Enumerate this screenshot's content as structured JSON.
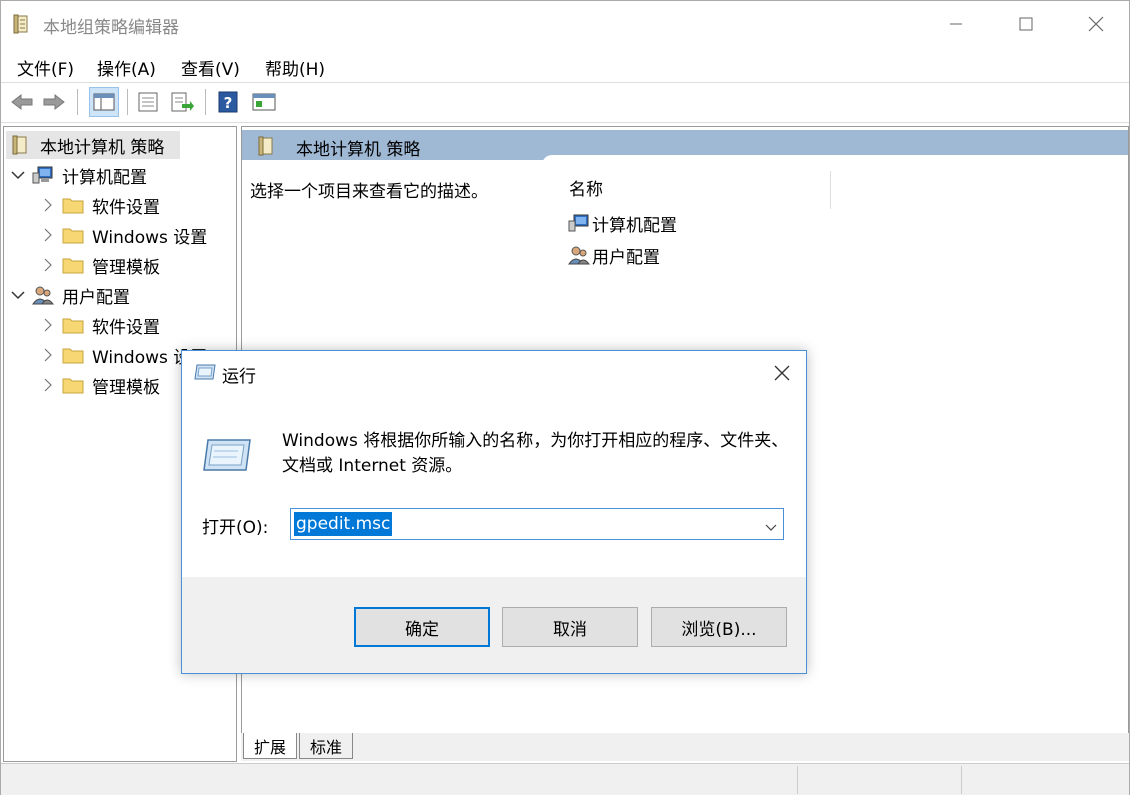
{
  "window": {
    "title": "本地组策略编辑器",
    "colors": {
      "header_band": "#9fb8d4",
      "accent": "#0078d7"
    }
  },
  "menu": [
    "文件(F)",
    "操作(A)",
    "查看(V)",
    "帮助(H)"
  ],
  "toolbar": {
    "icons": [
      "back-arrow-icon",
      "forward-arrow-icon",
      "show-hide-tree-icon",
      "properties-icon",
      "export-list-icon",
      "help-icon",
      "view-icon"
    ]
  },
  "tree": {
    "root": "本地计算机 策略",
    "computer": "计算机配置",
    "user": "用户配置",
    "children": [
      "软件设置",
      "Windows 设置",
      "管理模板"
    ],
    "user_children": [
      "软件设置",
      "Windows 设置",
      "管理模板"
    ]
  },
  "right": {
    "header_title": "本地计算机 策略",
    "description": "选择一个项目来查看它的描述。",
    "column_name": "名称",
    "items": [
      "计算机配置",
      "用户配置"
    ]
  },
  "tabs": [
    "扩展",
    "标准"
  ],
  "dialog": {
    "title": "运行",
    "message": "Windows 将根据你所输入的名称，为你打开相应的程序、文件夹、文档或 Internet 资源。",
    "open_label": "打开(O):",
    "input_value": "gpedit.msc",
    "ok": "确定",
    "cancel": "取消",
    "browse": "浏览(B)..."
  }
}
